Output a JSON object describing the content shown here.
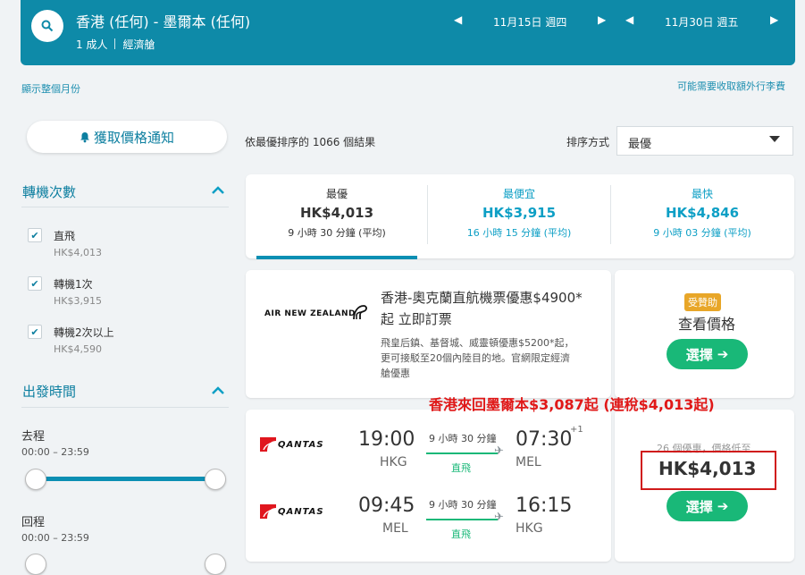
{
  "header": {
    "route": "香港 (任何) - 墨爾本 (任何)",
    "passengers": "1 成人",
    "cabin": "經濟艙",
    "depart_date": "11月15日 週四",
    "return_date": "11月30日 週五"
  },
  "links": {
    "show_month": "顯示整個月份",
    "extra_baggage": "可能需要收取額外行李費"
  },
  "sidebar": {
    "price_alert": "獲取價格通知",
    "stops_title": "轉機次數",
    "stops": [
      {
        "label": "直飛",
        "price": "HK$4,013",
        "checked": true
      },
      {
        "label": "轉機1次",
        "price": "HK$3,915",
        "checked": true
      },
      {
        "label": "轉機2次以上",
        "price": "HK$4,590",
        "checked": true
      }
    ],
    "time_title": "出發時間",
    "outbound_label": "去程",
    "outbound_range": "00:00 – 23:59",
    "return_label": "回程",
    "return_range": "00:00 – 23:59"
  },
  "results": {
    "summary": "依最優排序的 1066 個結果",
    "sort_label": "排序方式",
    "sort_value": "最優"
  },
  "tabs": [
    {
      "title": "最優",
      "price": "HK$4,013",
      "duration": "9 小時 30 分鐘 (平均)"
    },
    {
      "title": "最便宜",
      "price": "HK$3,915",
      "duration": "16 小時 15 分鐘 (平均)"
    },
    {
      "title": "最快",
      "price": "HK$4,846",
      "duration": "9 小時 03 分鐘 (平均)"
    }
  ],
  "ad": {
    "airline": "AIR NEW ZEALAND",
    "title_line1": "香港-奧克蘭直航機票優惠$4900*",
    "title_line2": "起 立即訂票",
    "desc_line1": "飛皇后鎮、基督城、威靈頓優惠$5200*起，",
    "desc_line2": "更可接駁至20個內陸目的地。官網限定經濟",
    "desc_line3": "艙優惠",
    "badge": "受贊助",
    "view_price": "查看價格",
    "select": "選擇"
  },
  "flight": {
    "airline": "QANTAS",
    "outbound": {
      "dep_time": "19:00",
      "dep_airport": "HKG",
      "duration": "9 小時 30 分鐘",
      "stops": "直飛",
      "arr_time": "07:30",
      "day_offset": "+1",
      "arr_airport": "MEL"
    },
    "inbound": {
      "dep_time": "09:45",
      "dep_airport": "MEL",
      "duration": "9 小時 30 分鐘",
      "stops": "直飛",
      "arr_time": "16:15",
      "arr_airport": "HKG"
    },
    "offers": "26 個優惠，價格低至",
    "price": "HK$4,013",
    "select": "選擇"
  },
  "annotation": "香港來回墨爾本$3,087起 (連稅$4,013起)",
  "colors": {
    "brand": "#0e8aa8",
    "accent": "#19b878",
    "highlight": "#e01818"
  }
}
